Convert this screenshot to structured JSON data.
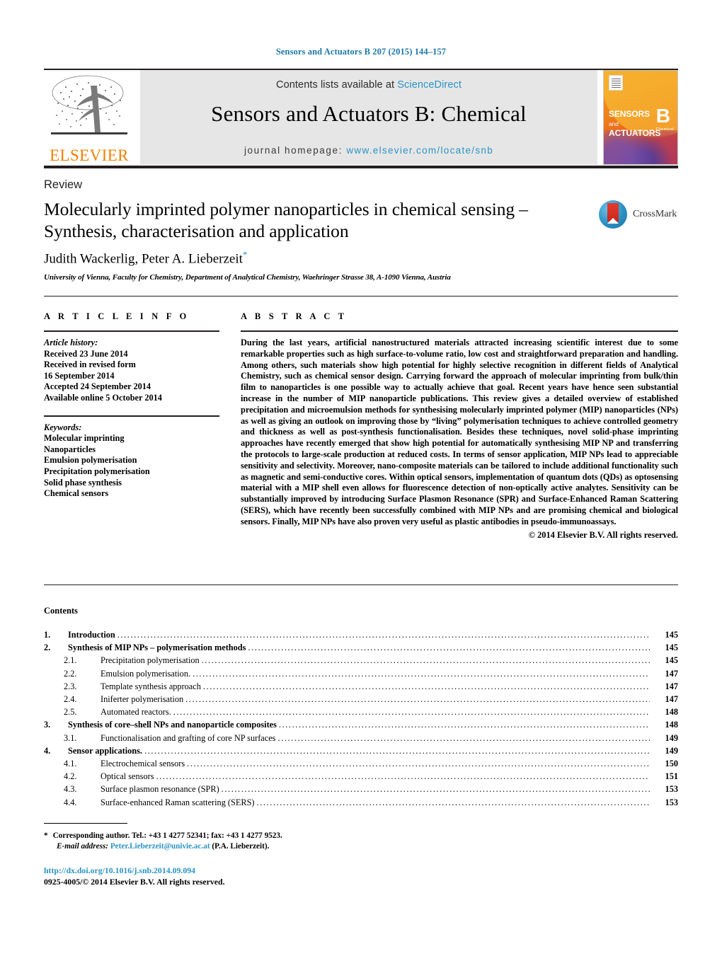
{
  "running_head": "Sensors and Actuators B 207 (2015) 144–157",
  "masthead": {
    "publisher": "ELSEVIER",
    "contents_prefix": "Contents lists available at ",
    "contents_link": "ScienceDirect",
    "journal_title": "Sensors and Actuators B: Chemical",
    "homepage_prefix": "journal homepage: ",
    "homepage_url": "www.elsevier.com/locate/snb",
    "cover": {
      "line1": "SENSORS",
      "and": "and",
      "line2": "ACTUATORS",
      "series": "B",
      "series_sub": "Chemical"
    }
  },
  "article": {
    "doctype": "Review",
    "title": "Molecularly imprinted polymer nanoparticles in chemical sensing – Synthesis, characterisation and application",
    "authors": "Judith Wackerlig, Peter A. Lieberzeit",
    "corresponding_marker": "*",
    "affiliation": "University of Vienna, Faculty for Chemistry, Department of Analytical Chemistry, Waehringer Strasse 38, A-1090 Vienna, Austria",
    "crossmark_label": "CrossMark"
  },
  "info": {
    "heading": "A R T I C L E   I N F O",
    "history_label": "Article history:",
    "history": [
      "Received 23 June 2014",
      "Received in revised form",
      "16 September 2014",
      "Accepted 24 September 2014",
      "Available online 5 October 2014"
    ],
    "keywords_label": "Keywords:",
    "keywords": [
      "Molecular imprinting",
      "Nanoparticles",
      "Emulsion polymerisation",
      "Precipitation polymerisation",
      "Solid phase synthesis",
      "Chemical sensors"
    ]
  },
  "abstract": {
    "heading": "A B S T R A C T",
    "body": "During the last years, artificial nanostructured materials attracted increasing scientific interest due to some remarkable properties such as high surface-to-volume ratio, low cost and straightforward preparation and handling. Among others, such materials show high potential for highly selective recognition in different fields of Analytical Chemistry, such as chemical sensor design. Carrying forward the approach of molecular imprinting from bulk/thin film to nanoparticles is one possible way to actually achieve that goal. Recent years have hence seen substantial increase in the number of MIP nanoparticle publications. This review gives a detailed overview of established precipitation and microemulsion methods for synthesising molecularly imprinted polymer (MIP) nanoparticles (NPs) as well as giving an outlook on improving those by “living” polymerisation techniques to achieve controlled geometry and thickness as well as post-synthesis functionalisation. Besides these techniques, novel solid-phase imprinting approaches have recently emerged that show high potential for automatically synthesising MIP NP and transferring the protocols to large-scale production at reduced costs. In terms of sensor application, MIP NPs lead to appreciable sensitivity and selectivity. Moreover, nano-composite materials can be tailored to include additional functionality such as magnetic and semi-conductive cores. Within optical sensors, implementation of quantum dots (QDs) as optosensing material with a MIP shell even allows for fluorescence detection of non-optically active analytes. Sensitivity can be substantially improved by introducing Surface Plasmon Resonance (SPR) and Surface-Enhanced Raman Scattering (SERS), which have recently been successfully combined with MIP NPs and are promising chemical and biological sensors. Finally, MIP NPs have also proven very useful as plastic antibodies in pseudo-immunoassays.",
    "copyright": "© 2014 Elsevier B.V. All rights reserved."
  },
  "contents": {
    "heading": "Contents",
    "entries": [
      {
        "num": "1.",
        "label": "Introduction",
        "page": "145",
        "level": 1
      },
      {
        "num": "2.",
        "label": "Synthesis of MIP NPs – polymerisation methods",
        "page": "145",
        "level": 1
      },
      {
        "num": "2.1.",
        "label": "Precipitation polymerisation",
        "page": "145",
        "level": 2
      },
      {
        "num": "2.2.",
        "label": "Emulsion polymerisation.",
        "page": "147",
        "level": 2
      },
      {
        "num": "2.3.",
        "label": "Template synthesis approach",
        "page": "147",
        "level": 2
      },
      {
        "num": "2.4.",
        "label": "Iniferter polymerisation",
        "page": "147",
        "level": 2
      },
      {
        "num": "2.5.",
        "label": "Automated reactors.",
        "page": "148",
        "level": 2
      },
      {
        "num": "3.",
        "label": "Synthesis of core–shell NPs and nanoparticle composites",
        "page": "148",
        "level": 1
      },
      {
        "num": "3.1.",
        "label": "Functionalisation and grafting of core NP surfaces",
        "page": "149",
        "level": 2
      },
      {
        "num": "4.",
        "label": "Sensor applications.",
        "page": "149",
        "level": 1
      },
      {
        "num": "4.1.",
        "label": "Electrochemical sensors",
        "page": "150",
        "level": 2
      },
      {
        "num": "4.2.",
        "label": "Optical sensors",
        "page": "151",
        "level": 2
      },
      {
        "num": "4.3.",
        "label": "Surface plasmon resonance (SPR)",
        "page": "153",
        "level": 2
      },
      {
        "num": "4.4.",
        "label": "Surface-enhanced Raman scattering (SERS)",
        "page": "153",
        "level": 2
      }
    ]
  },
  "footer": {
    "corresponding_star": "*",
    "corresponding_text": "Corresponding author. Tel.: +43 1 4277 52341; fax: +43 1 4277 9523.",
    "email_label": "E-mail address:",
    "email": "Peter.Lieberzeit@univie.ac.at",
    "email_owner": "(P.A. Lieberzeit).",
    "doi": "http://dx.doi.org/10.1016/j.snb.2014.09.094",
    "issn": "0925-4005/© 2014 Elsevier B.V. All rights reserved."
  },
  "colors": {
    "link_teal": "#2a94c6",
    "running_head": "#1b78a8",
    "elsevier_orange": "#f08000",
    "band_gray": "#e6e6e6",
    "rule_black": "#231f20"
  }
}
